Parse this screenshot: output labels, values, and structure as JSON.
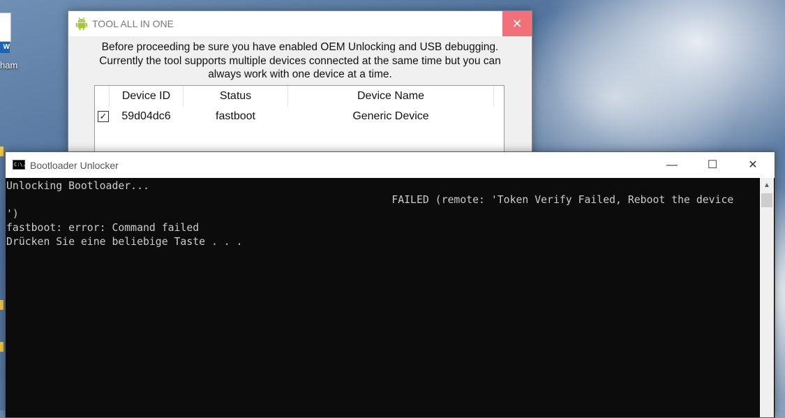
{
  "desktop": {
    "icon_badge": "W",
    "icon_label": "ham"
  },
  "tool_window": {
    "title": "TOOL ALL IN ONE",
    "close_glyph": "✕",
    "message_lines": [
      "Before proceeding be sure you have enabled OEM Unlocking and USB debugging.",
      "Currently the tool supports multiple devices connected at the same time but you can",
      "always work with one device at a time."
    ],
    "table": {
      "columns": [
        "Device ID",
        "Status",
        "Device Name"
      ],
      "rows": [
        {
          "checked": true,
          "check_glyph": "✓",
          "device_id": "59d04dc6",
          "status": "fastboot",
          "device_name": "Generic Device"
        }
      ]
    }
  },
  "console_window": {
    "title": "Bootloader Unlocker",
    "icon_text": "C:\\.",
    "minimize_glyph": "—",
    "maximize_glyph": "☐",
    "close_glyph": "✕",
    "lines": [
      "Unlocking Bootloader...",
      "                                                              FAILED (remote: 'Token Verify Failed, Reboot the device",
      "')",
      "fastboot: error: Command failed",
      "Drücken Sie eine beliebige Taste . . ."
    ],
    "scroll_up_glyph": "▲"
  },
  "colors": {
    "close_hover": "#f1707a",
    "console_bg": "#0c0c0c",
    "console_text": "#cccccc",
    "android_green": "#a4c639"
  }
}
